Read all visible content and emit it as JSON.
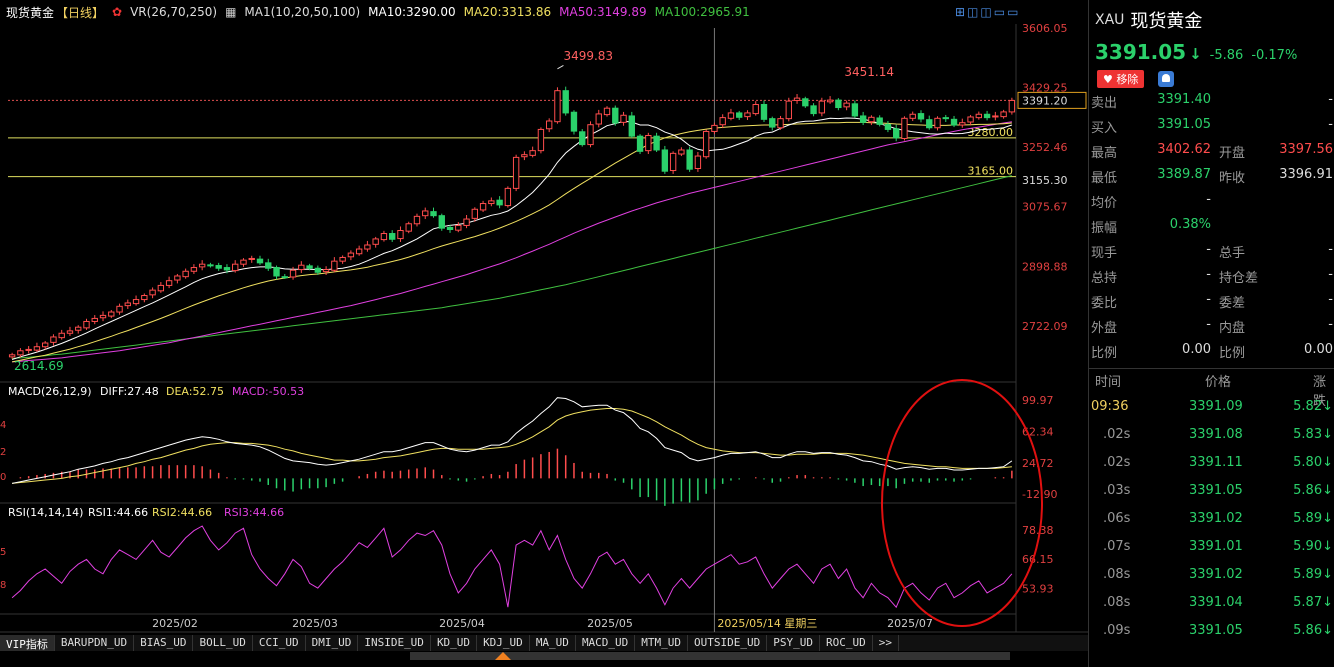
{
  "header": {
    "name": "现货黄金",
    "period": "【日线】",
    "vr_label": "VR(26,70,250)",
    "ma_label": "MA1(10,20,50,100)",
    "ma10": "MA10:3290.00",
    "ma20": "MA20:3313.86",
    "ma50": "MA50:3149.89",
    "ma100": "MA100:2965.91"
  },
  "colors": {
    "up": "#ff4d4d",
    "down": "#2bd16b",
    "ma10": "#ffffff",
    "ma20": "#f0e060",
    "ma50": "#e040e0",
    "ma100": "#40c040",
    "bg": "#000000",
    "grid": "#303030"
  },
  "chart_data": [
    {
      "type": "candlestick",
      "title": "现货黄金 【日线】",
      "ylim": [
        2614.69,
        3606.05
      ],
      "y_ticks": [
        "3606.05",
        "3429.25",
        "3252.46",
        "3075.67",
        "2898.88",
        "2722.09"
      ],
      "price_labels": {
        "current": "3391.20",
        "level1": "3280.00",
        "level2": "3165.00",
        "level3": "3155.30"
      },
      "high_label": "3499.83",
      "high2_label": "3451.14",
      "low_label": "2614.69",
      "x_labels": [
        "2025/02",
        "2025/03",
        "2025/04",
        "2025/05",
        "2025/06",
        "2025/07"
      ],
      "crosshair_label": "2025/05/14 星期三",
      "close": [
        2636,
        2648,
        2652,
        2660,
        2671,
        2689,
        2700,
        2707,
        2718,
        2735,
        2744,
        2753,
        2763,
        2780,
        2790,
        2800,
        2812,
        2828,
        2842,
        2856,
        2870,
        2884,
        2895,
        2905,
        2901,
        2893,
        2888,
        2905,
        2917,
        2922,
        2909,
        2893,
        2870,
        2867,
        2887,
        2902,
        2893,
        2881,
        2889,
        2914,
        2925,
        2938,
        2950,
        2962,
        2980,
        2996,
        2979,
        3005,
        3025,
        3047,
        3063,
        3049,
        3012,
        3008,
        3020,
        3039,
        3068,
        3085,
        3093,
        3081,
        3130,
        3222,
        3230,
        3242,
        3305,
        3330,
        3420,
        3354,
        3300,
        3260,
        3319,
        3351,
        3368,
        3324,
        3347,
        3285,
        3240,
        3287,
        3244,
        3181,
        3234,
        3244,
        3187,
        3226,
        3299,
        3317,
        3340,
        3354,
        3341,
        3354,
        3379,
        3335,
        3312,
        3337,
        3389,
        3398,
        3375,
        3352,
        3389,
        3392,
        3370,
        3383,
        3345,
        3326,
        3341,
        3320,
        3305,
        3280,
        3338,
        3350,
        3336,
        3310,
        3338,
        3337,
        3318,
        3325,
        3342,
        3350,
        3340,
        3345,
        3357,
        3391
      ],
      "ma10": [
        2622,
        2630,
        2637,
        2644,
        2652,
        2661,
        2670,
        2680,
        2690,
        2701,
        2713,
        2724,
        2735,
        2746,
        2757,
        2768,
        2779,
        2790,
        2802,
        2814,
        2826,
        2838,
        2851,
        2862,
        2870,
        2877,
        2882,
        2886,
        2891,
        2895,
        2897,
        2897,
        2895,
        2891,
        2890,
        2890,
        2890,
        2889,
        2889,
        2891,
        2893,
        2898,
        2905,
        2915,
        2926,
        2937,
        2945,
        2956,
        2968,
        2980,
        2995,
        3010,
        3016,
        3020,
        3023,
        3027,
        3034,
        3042,
        3050,
        3055,
        3063,
        3079,
        3098,
        3118,
        3144,
        3172,
        3207,
        3235,
        3255,
        3273,
        3289,
        3302,
        3316,
        3322,
        3329,
        3327,
        3318,
        3318,
        3310,
        3297,
        3289,
        3276,
        3257,
        3246,
        3241,
        3244,
        3246,
        3253,
        3262,
        3271,
        3285,
        3294,
        3297,
        3308,
        3318,
        3326,
        3329,
        3330,
        3334,
        3338,
        3337,
        3339,
        3338,
        3335,
        3330,
        3322,
        3315,
        3307,
        3302,
        3298,
        3295,
        3292,
        3291,
        3294,
        3292,
        3293,
        3297,
        3304,
        3305,
        3307,
        3310,
        3318
      ],
      "ma20": [
        2615,
        2620,
        2625,
        2630,
        2635,
        2641,
        2647,
        2653,
        2660,
        2667,
        2675,
        2683,
        2691,
        2700,
        2708,
        2717,
        2726,
        2735,
        2744,
        2754,
        2764,
        2774,
        2784,
        2793,
        2802,
        2811,
        2819,
        2827,
        2835,
        2842,
        2849,
        2855,
        2860,
        2864,
        2868,
        2871,
        2874,
        2876,
        2879,
        2882,
        2885,
        2888,
        2892,
        2896,
        2902,
        2907,
        2913,
        2919,
        2926,
        2934,
        2942,
        2951,
        2959,
        2966,
        2973,
        2980,
        2987,
        2995,
        3003,
        3012,
        3022,
        3032,
        3043,
        3055,
        3067,
        3081,
        3097,
        3114,
        3130,
        3145,
        3160,
        3175,
        3190,
        3205,
        3219,
        3233,
        3247,
        3260,
        3270,
        3280,
        3287,
        3293,
        3298,
        3302,
        3306,
        3309,
        3311,
        3313,
        3315,
        3316,
        3317,
        3318,
        3318,
        3319,
        3320,
        3321,
        3322,
        3323,
        3324,
        3325,
        3325,
        3326,
        3326,
        3326,
        3325,
        3324,
        3323,
        3321,
        3320,
        3319,
        3318,
        3317,
        3317,
        3317,
        3318,
        3318,
        3319,
        3320,
        3320,
        3321,
        3322,
        3324
      ],
      "ma50": [
        2615,
        2617,
        2619,
        2621,
        2623,
        2625,
        2627,
        2630,
        2633,
        2636,
        2639,
        2642,
        2645,
        2648,
        2652,
        2656,
        2660,
        2664,
        2668,
        2672,
        2677,
        2682,
        2687,
        2692,
        2697,
        2702,
        2707,
        2712,
        2717,
        2722,
        2727,
        2732,
        2737,
        2742,
        2747,
        2752,
        2757,
        2762,
        2767,
        2772,
        2777,
        2782,
        2788,
        2794,
        2800,
        2806,
        2812,
        2818,
        2825,
        2832,
        2839,
        2846,
        2853,
        2860,
        2867,
        2874,
        2882,
        2890,
        2898,
        2906,
        2915,
        2924,
        2934,
        2944,
        2954,
        2964,
        2975,
        2986,
        2997,
        3007,
        3017,
        3027,
        3036,
        3045,
        3054,
        3063,
        3071,
        3079,
        3087,
        3094,
        3101,
        3108,
        3115,
        3121,
        3127,
        3133,
        3139,
        3145,
        3151,
        3157,
        3163,
        3169,
        3175,
        3181,
        3187,
        3193,
        3199,
        3205,
        3211,
        3217,
        3223,
        3229,
        3235,
        3241,
        3247,
        3253,
        3259,
        3264,
        3269,
        3274,
        3279,
        3284,
        3289,
        3294,
        3299,
        3304,
        3308,
        3312,
        3316,
        3320,
        3324,
        3328
      ],
      "ma100": [
        2625,
        2627,
        2629,
        2631,
        2633,
        2636,
        2638,
        2641,
        2644,
        2647,
        2650,
        2653,
        2656,
        2659,
        2662,
        2665,
        2668,
        2671,
        2674,
        2677,
        2680,
        2683,
        2686,
        2689,
        2692,
        2695,
        2698,
        2701,
        2704,
        2707,
        2710,
        2713,
        2716,
        2719,
        2722,
        2725,
        2728,
        2731,
        2734,
        2737,
        2740,
        2743,
        2746,
        2749,
        2752,
        2755,
        2758,
        2761,
        2764,
        2767,
        2770,
        2773,
        2776,
        2780,
        2784,
        2788,
        2792,
        2796,
        2800,
        2804,
        2809,
        2814,
        2819,
        2824,
        2829,
        2834,
        2839,
        2844,
        2850,
        2856,
        2862,
        2868,
        2874,
        2880,
        2886,
        2892,
        2898,
        2904,
        2910,
        2916,
        2922,
        2928,
        2934,
        2940,
        2946,
        2952,
        2958,
        2964,
        2970,
        2976,
        2982,
        2988,
        2994,
        3000,
        3006,
        3012,
        3018,
        3024,
        3030,
        3036,
        3042,
        3048,
        3054,
        3060,
        3066,
        3072,
        3078,
        3084,
        3090,
        3096,
        3102,
        3108,
        3114,
        3120,
        3126,
        3132,
        3138,
        3144,
        3150,
        3156,
        3162,
        3168
      ]
    },
    {
      "type": "bar",
      "title": "MACD(26,12,9)",
      "series_labels": {
        "diff": "DIFF:27.48",
        "dea": "DEA:52.75",
        "macd": "MACD:-50.53"
      },
      "y_ticks": [
        "99.97",
        "62.34",
        "24.72",
        "-12.90"
      ],
      "left_ticks": [
        "4",
        "2",
        "0"
      ],
      "ylim": [
        -20,
        105
      ],
      "diff": [
        0,
        2,
        4,
        6,
        8,
        10,
        12,
        14,
        17,
        19,
        21,
        24,
        26,
        29,
        31,
        34,
        37,
        40,
        43,
        46,
        49,
        52,
        54,
        56,
        55,
        53,
        50,
        48,
        47,
        46,
        44,
        40,
        35,
        30,
        27,
        26,
        25,
        23,
        22,
        23,
        25,
        27,
        29,
        32,
        35,
        38,
        38,
        40,
        43,
        46,
        49,
        49,
        45,
        41,
        39,
        38,
        40,
        43,
        46,
        46,
        50,
        60,
        68,
        75,
        84,
        92,
        103,
        102,
        98,
        92,
        93,
        94,
        94,
        88,
        85,
        77,
        66,
        62,
        54,
        43,
        40,
        37,
        30,
        27,
        29,
        31,
        34,
        36,
        36,
        37,
        38,
        35,
        31,
        31,
        35,
        38,
        38,
        36,
        37,
        37,
        35,
        34,
        31,
        27,
        26,
        23,
        21,
        17,
        19,
        20,
        19,
        17,
        18,
        18,
        16,
        16,
        17,
        18,
        18,
        19,
        20,
        27
      ],
      "dea": [
        0,
        1,
        2,
        3,
        4,
        5,
        6,
        8,
        9,
        11,
        13,
        15,
        17,
        19,
        21,
        24,
        26,
        29,
        31,
        34,
        37,
        40,
        42,
        45,
        47,
        48,
        49,
        49,
        48,
        48,
        47,
        46,
        44,
        41,
        39,
        36,
        34,
        32,
        30,
        28,
        28,
        27,
        27,
        28,
        29,
        31,
        32,
        33,
        35,
        37,
        39,
        41,
        42,
        42,
        41,
        41,
        41,
        41,
        42,
        43,
        44,
        47,
        51,
        56,
        62,
        68,
        76,
        81,
        84,
        86,
        88,
        89,
        90,
        90,
        89,
        87,
        83,
        79,
        74,
        68,
        63,
        58,
        52,
        47,
        43,
        41,
        39,
        38,
        37,
        37,
        37,
        36,
        35,
        34,
        34,
        35,
        35,
        35,
        36,
        36,
        36,
        36,
        35,
        34,
        32,
        30,
        28,
        26,
        24,
        23,
        22,
        21,
        20,
        20,
        19,
        18,
        18,
        18,
        18,
        18,
        19,
        20
      ]
    },
    {
      "type": "line",
      "title": "RSI(14,14,14)",
      "series_labels": {
        "rsi1": "RSI1:44.66",
        "rsi2": "RSI2:44.66",
        "rsi3": "RSI3:44.66"
      },
      "y_ticks": [
        "78.38",
        "66.15",
        "53.93"
      ],
      "left_ticks": [
        "5",
        "8"
      ],
      "ylim": [
        44,
        85
      ],
      "values": [
        50,
        53,
        57,
        60,
        62,
        59,
        56,
        61,
        64,
        66,
        62,
        60,
        66,
        70,
        68,
        66,
        70,
        74,
        69,
        67,
        71,
        75,
        78,
        80,
        74,
        70,
        73,
        77,
        79,
        68,
        62,
        58,
        55,
        60,
        66,
        63,
        56,
        54,
        58,
        62,
        65,
        69,
        73,
        71,
        75,
        79,
        67,
        70,
        74,
        77,
        76,
        78,
        72,
        60,
        52,
        56,
        62,
        66,
        70,
        64,
        46,
        72,
        74,
        72,
        78,
        70,
        76,
        66,
        58,
        54,
        60,
        67,
        69,
        64,
        66,
        60,
        56,
        60,
        54,
        47,
        54,
        58,
        54,
        58,
        62,
        64,
        66,
        68,
        64,
        65,
        67,
        60,
        54,
        58,
        62,
        64,
        60,
        56,
        62,
        64,
        58,
        62,
        54,
        50,
        56,
        52,
        50,
        46,
        54,
        56,
        52,
        49,
        54,
        56,
        50,
        52,
        55,
        57,
        52,
        54,
        56,
        60
      ]
    }
  ],
  "panel": {
    "symbol": "XAU",
    "name": "现货黄金",
    "price": "3391.05",
    "arrow": "↓",
    "change": "-5.86",
    "change_pct": "-0.17%",
    "remove_btn": "移除",
    "quotes": [
      {
        "l": "卖出",
        "v": "3391.40",
        "l2": "",
        "v2": "-"
      },
      {
        "l": "买入",
        "v": "3391.05",
        "l2": "",
        "v2": "-"
      },
      {
        "l": "最高",
        "v": "3402.62",
        "l2": "开盘",
        "v2": "3397.56"
      },
      {
        "l": "最低",
        "v": "3389.87",
        "l2": "昨收",
        "v2": "3396.91"
      },
      {
        "l": "均价",
        "v": "-",
        "l2": "",
        "v2": ""
      },
      {
        "l": "振幅",
        "v": "0.38%",
        "l2": "",
        "v2": ""
      },
      {
        "l": "现手",
        "v": "-",
        "l2": "总手",
        "v2": "-"
      },
      {
        "l": "总持",
        "v": "-",
        "l2": "持仓差",
        "v2": "-"
      },
      {
        "l": "委比",
        "v": "-",
        "l2": "委差",
        "v2": "-"
      },
      {
        "l": "外盘",
        "v": "-",
        "l2": "内盘",
        "v2": "-"
      },
      {
        "l": "比例",
        "v": "0.00",
        "l2": "比例",
        "v2": "0.00"
      }
    ],
    "ticks_header": {
      "time": "时间",
      "price": "价格",
      "chg": "涨跌"
    },
    "ticks": [
      {
        "t": "09:36",
        "p": "3391.09",
        "c": "5.82↓"
      },
      {
        "t": ".02s",
        "p": "3391.08",
        "c": "5.83↓"
      },
      {
        "t": ".02s",
        "p": "3391.11",
        "c": "5.80↓"
      },
      {
        "t": ".03s",
        "p": "3391.05",
        "c": "5.86↓"
      },
      {
        "t": ".06s",
        "p": "3391.02",
        "c": "5.89↓"
      },
      {
        "t": ".07s",
        "p": "3391.01",
        "c": "5.90↓"
      },
      {
        "t": ".08s",
        "p": "3391.02",
        "c": "5.89↓"
      },
      {
        "t": ".08s",
        "p": "3391.04",
        "c": "5.87↓"
      },
      {
        "t": ".09s",
        "p": "3391.05",
        "c": "5.86↓"
      }
    ]
  },
  "tabs": [
    "VIP指标",
    "BARUPDN_UD",
    "BIAS_UD",
    "BOLL_UD",
    "CCI_UD",
    "DMI_UD",
    "INSIDE_UD",
    "KD_UD",
    "KDJ_UD",
    "MA_UD",
    "MACD_UD",
    "MTM_UD",
    "OUTSIDE_UD",
    "PSY_UD",
    "ROC_UD",
    ">>"
  ]
}
